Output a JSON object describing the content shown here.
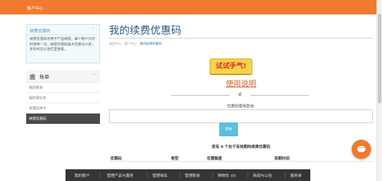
{
  "topbar": {
    "brand": "客户中心"
  },
  "sidebar": {
    "promo": {
      "title": "续费优惠码",
      "text": "续费优惠码可用于产品续费。每个账户只可时使用一次。续费优惠码最大优惠为六折。折扣可在公告栏里查看。"
    },
    "account": {
      "title": "账单",
      "items": [
        "我的账单",
        "我的报价单",
        "管理信用卡",
        "续费优惠码"
      ]
    }
  },
  "main": {
    "title": "我的续费优惠码",
    "breadcrumb": [
      "返回中心",
      "客户中心",
      "我的续费优惠码"
    ],
    "try_button": "试试手气!",
    "usage_link": "使用说明",
    "or_text": "或",
    "query_label": "优惠码使用查询:",
    "query_value": "",
    "search_button": "搜索",
    "count_text": "您有 0 个处于有效期的续费优惠码",
    "table_headers": [
      "优惠码",
      "类型",
      "优惠额度",
      "到期时间"
    ]
  },
  "bottom_nav": [
    "我的账户",
    "管理产品与服务",
    "管理域名",
    "管理账单",
    "购物车 (0)",
    "新闻与公告",
    "服务单"
  ],
  "colors": {
    "brand": "#f07b2f",
    "title": "#2f5b86",
    "search_button": "#5bc0de",
    "bottom_bar": "#353535"
  }
}
